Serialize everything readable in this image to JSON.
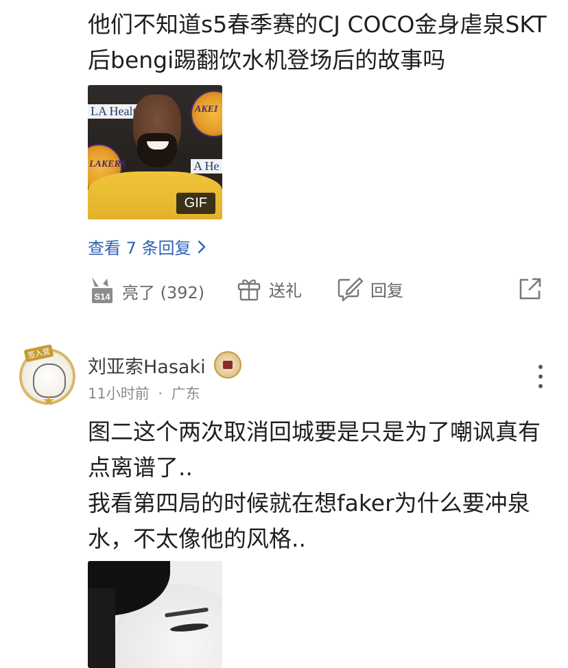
{
  "top_comment": {
    "text": "他们不知道s5春季赛的CJ COCO金身虐泉SKT后bengi踢翻饮水机登场后的故事吗",
    "media": {
      "badge": "GIF",
      "sponsor_left": "LA Healt",
      "sponsor_right": "A He",
      "logo_left_text": "LAKERS",
      "logo_right_text": "AKEI"
    },
    "view_replies": "查看 7 条回复",
    "actions": {
      "like_label": "亮了 (392)",
      "like_icon_text": "S14",
      "gift_label": "送礼",
      "reply_label": "回复"
    }
  },
  "second_comment": {
    "avatar_tag": "签入营",
    "username": "刘亚索Hasaki",
    "time": "11小时前",
    "separator": "·",
    "location": "广东",
    "text": "图二这个两次取消回城要是只是为了嘲讽真有点离谱了..\n我看第四局的时候就在想faker为什么要冲泉水，不太像他的风格.."
  },
  "colors": {
    "link": "#2f62b0",
    "meta": "#8a8a8a",
    "action": "#666666"
  }
}
